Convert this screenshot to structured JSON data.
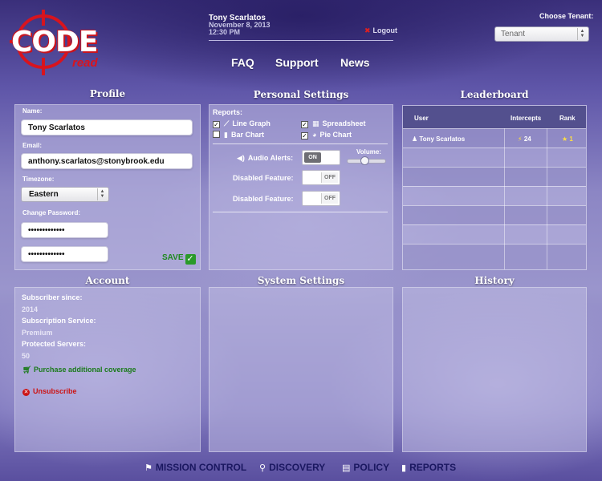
{
  "header": {
    "logo": {
      "main": "CODE",
      "sub": "read"
    },
    "user": {
      "name": "Tony Scarlatos",
      "date": "November 8, 2013",
      "time": "12:30 PM"
    },
    "logout_label": "Logout",
    "nav": [
      "FAQ",
      "Support",
      "News"
    ],
    "tenant": {
      "label": "Choose Tenant:",
      "value": "Tenant"
    }
  },
  "profile": {
    "title": "Profile",
    "name_label": "Name:",
    "name_value": "Tony Scarlatos",
    "email_label": "Email:",
    "email_value": "anthony.scarlatos@stonybrook.edu",
    "timezone_label": "Timezone:",
    "timezone_value": "Eastern",
    "password_label": "Change Password:",
    "password_value": "•••••••••••••",
    "password_confirm_value": "•••••••••••••",
    "save_label": "SAVE"
  },
  "settings": {
    "title": "Personal Settings",
    "reports_label": "Reports:",
    "reports": [
      {
        "label": "Line Graph",
        "checked": true,
        "icon": "line-graph-icon"
      },
      {
        "label": "Spreadsheet",
        "checked": true,
        "icon": "spreadsheet-icon"
      },
      {
        "label": "Bar Chart",
        "checked": false,
        "icon": "bar-chart-icon"
      },
      {
        "label": "Pie Chart",
        "checked": true,
        "icon": "pie-chart-icon"
      }
    ],
    "audio_label": "Audio Alerts:",
    "audio_state": "ON",
    "volume_label": "Volume:",
    "volume_level": 0.45,
    "disabled1_label": "Disabled Feature:",
    "disabled1_state": "OFF",
    "disabled2_label": "Disabled Feature:",
    "disabled2_state": "OFF"
  },
  "leaderboard": {
    "title": "Leaderboard",
    "columns": [
      "User",
      "Intercepts",
      "Rank"
    ],
    "rows": [
      {
        "user": "Tony Scarlatos",
        "intercepts": "24",
        "rank": "1"
      }
    ]
  },
  "account": {
    "title": "Account",
    "subscriber_label": "Subscriber since:",
    "subscriber_value": "2014",
    "service_label": "Subscription Service:",
    "service_value": "Premium",
    "servers_label": "Protected Servers:",
    "servers_value": "50",
    "purchase_label": "Purchase additional coverage",
    "unsubscribe_label": "Unsubscribe"
  },
  "system": {
    "title": "System Settings"
  },
  "history": {
    "title": "History"
  },
  "bottom_nav": [
    {
      "label": "MISSION CONTROL",
      "icon": "flag-icon"
    },
    {
      "label": "DISCOVERY",
      "icon": "magnifier-icon"
    },
    {
      "label": "POLICY",
      "icon": "book-icon"
    },
    {
      "label": "REPORTS",
      "icon": "bar-chart-icon"
    }
  ],
  "colors": {
    "save": "#1f8a1f",
    "unsubscribe": "#cc1414",
    "logo_red": "#d8141e",
    "bottom_nav": "#1a1760"
  }
}
